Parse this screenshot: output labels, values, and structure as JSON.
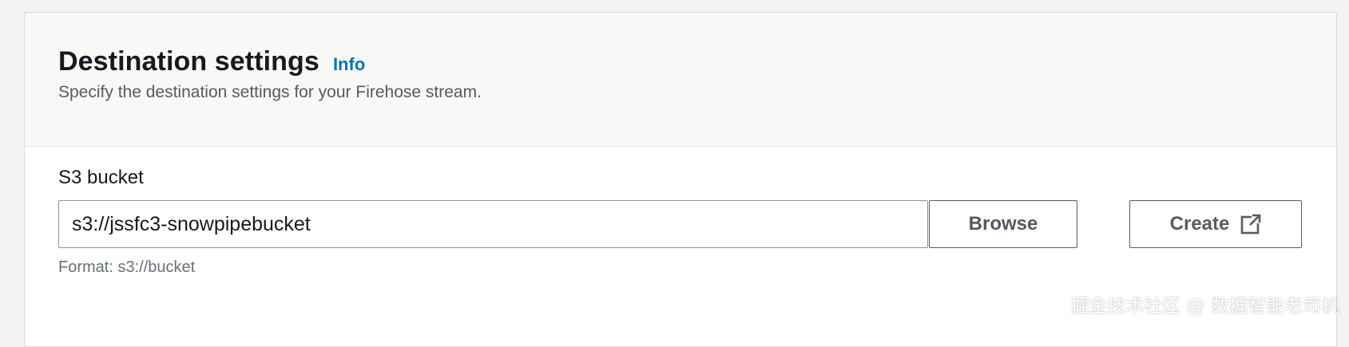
{
  "section": {
    "title": "Destination settings",
    "info_link": "Info",
    "description": "Specify the destination settings for your Firehose stream."
  },
  "s3_bucket": {
    "label": "S3 bucket",
    "value": "s3://jssfc3-snowpipebucket",
    "hint": "Format: s3://bucket",
    "browse_label": "Browse",
    "create_label": "Create",
    "create_icon": "external-link-icon"
  },
  "watermark": "掘金技术社区 @ 数据智能老司机",
  "colors": {
    "link": "#0073bb",
    "title_text": "#16191f",
    "secondary_text": "#545b64",
    "header_background": "#f8f8f6"
  }
}
